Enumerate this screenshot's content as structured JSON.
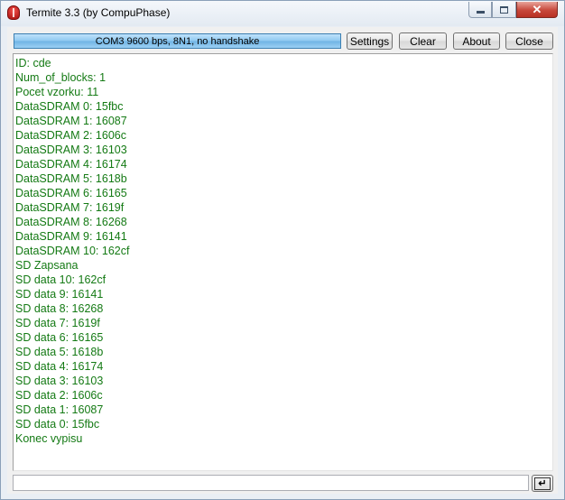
{
  "window": {
    "title": "Termite 3.3 (by CompuPhase)",
    "icon": "termite-app-icon",
    "controls": {
      "minimize_icon": "minimize-icon",
      "maximize_icon": "maximize-icon",
      "close_glyph": "✕"
    }
  },
  "toolbar": {
    "status": "COM3 9600 bps, 8N1, no handshake",
    "settings_label": "Settings",
    "clear_label": "Clear",
    "about_label": "About",
    "close_label": "Close"
  },
  "output": {
    "text_color": "#147a14",
    "lines": [
      "ID: cde",
      "Num_of_blocks: 1",
      "Pocet vzorku: 11",
      "DataSDRAM 0: 15fbc",
      "DataSDRAM 1: 16087",
      "DataSDRAM 2: 1606c",
      "DataSDRAM 3: 16103",
      "DataSDRAM 4: 16174",
      "DataSDRAM 5: 1618b",
      "DataSDRAM 6: 16165",
      "DataSDRAM 7: 1619f",
      "DataSDRAM 8: 16268",
      "DataSDRAM 9: 16141",
      "DataSDRAM 10: 162cf",
      "SD Zapsana",
      "SD data 10: 162cf",
      "SD data 9: 16141",
      "SD data 8: 16268",
      "SD data 7: 1619f",
      "SD data 6: 16165",
      "SD data 5: 1618b",
      "SD data 4: 16174",
      "SD data 3: 16103",
      "SD data 2: 1606c",
      "SD data 1: 16087",
      "SD data 0: 15fbc",
      "Konec vypisu"
    ]
  },
  "input": {
    "value": "",
    "placeholder": ""
  },
  "send_button": {
    "glyph": "↵",
    "icon": "enter-icon"
  }
}
